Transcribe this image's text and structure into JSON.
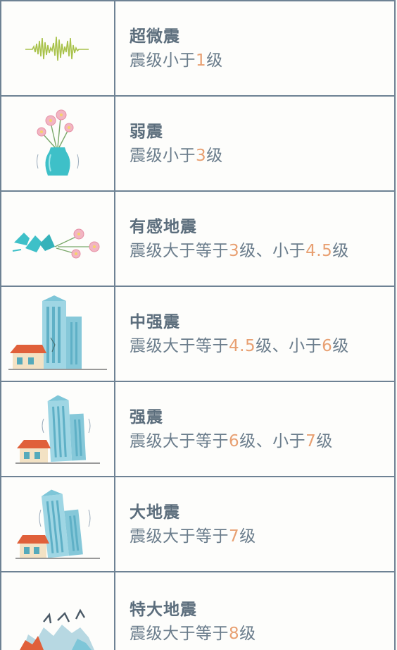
{
  "levels": [
    {
      "title": "超微震",
      "desc": [
        {
          "t": "震级小于"
        },
        {
          "t": "1",
          "n": true
        },
        {
          "t": "级"
        }
      ],
      "icon": "seismograph-wave-icon"
    },
    {
      "title": "弱震",
      "desc": [
        {
          "t": "震级小于"
        },
        {
          "t": "3",
          "n": true
        },
        {
          "t": "级"
        }
      ],
      "icon": "shaking-vase-icon"
    },
    {
      "title": "有感地震",
      "desc": [
        {
          "t": "震级大于等于"
        },
        {
          "t": "3",
          "n": true
        },
        {
          "t": "级、小于"
        },
        {
          "t": "4.5",
          "n": true
        },
        {
          "t": "级"
        }
      ],
      "icon": "broken-vase-icon"
    },
    {
      "title": "中强震",
      "desc": [
        {
          "t": "震级大于等于"
        },
        {
          "t": "4.5",
          "n": true
        },
        {
          "t": "级、小于"
        },
        {
          "t": "6",
          "n": true
        },
        {
          "t": "级"
        }
      ],
      "icon": "cracked-buildings-icon"
    },
    {
      "title": "强震",
      "desc": [
        {
          "t": "震级大于等于"
        },
        {
          "t": "6",
          "n": true
        },
        {
          "t": "级、小于"
        },
        {
          "t": "7",
          "n": true
        },
        {
          "t": "级"
        }
      ],
      "icon": "shaking-buildings-icon"
    },
    {
      "title": "大地震",
      "desc": [
        {
          "t": "震级大于等于"
        },
        {
          "t": "7",
          "n": true
        },
        {
          "t": "级"
        }
      ],
      "icon": "leaning-buildings-icon"
    },
    {
      "title": "特大地震",
      "desc": [
        {
          "t": "震级大于等于"
        },
        {
          "t": "8",
          "n": true
        },
        {
          "t": "级"
        }
      ],
      "icon": "collapsed-rubble-icon"
    }
  ],
  "colors": {
    "border": "#6e8294",
    "title": "#5b6d7c",
    "text": "#6b7d8c",
    "number": "#e8a072"
  }
}
